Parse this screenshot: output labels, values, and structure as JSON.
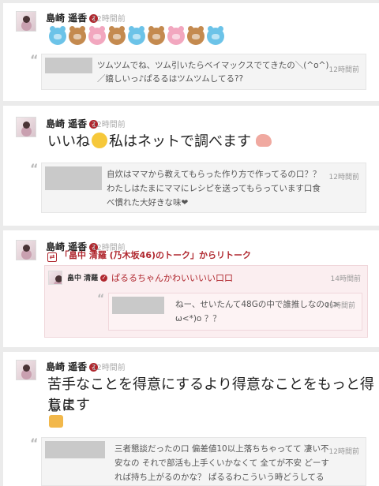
{
  "posts": [
    {
      "author": "島崎 遥香",
      "time": "12時間前",
      "emoji": [
        "blue-bear-icon",
        "brown-bear-icon",
        "pink-pig-icon",
        "brown-bear-icon",
        "blue-bear-icon",
        "brown-bear-icon",
        "pink-pig-icon",
        "brown-bear-icon",
        "blue-bear-icon"
      ],
      "reply": {
        "text_line1": "ツムツムでね、ツム引いたらベイマックスでてきたの＼(^o^)",
        "text_line2": "／嬉しいっ♪ぱるるはツムツムしてる??",
        "time": "12時間前"
      }
    },
    {
      "author": "島崎 遥香",
      "time": "12時間前",
      "text_before": "いいね",
      "text_after": "私はネットで調べます",
      "reply": {
        "text_line1": "自炊はママから教えてもらった作り方で作ってるの口？？",
        "text_line2": "わたしはたまにママにレシピを送ってもらっています口食",
        "text_line3": "べ慣れた大好きな味❤",
        "time": "12時間前"
      }
    },
    {
      "author": "島崎 遥香",
      "time": "12時間前",
      "retalk_label": "「畠中 清羅 (乃木坂46)のトーク」からリトーク",
      "retalk": {
        "author": "畠中 清羅",
        "text": "ぱるるちゃんかわいいいい口口",
        "time": "14時間前",
        "reply": {
          "text_line1": "ねー、せいたんて48Gの中で誰推しなのo(>",
          "text_line2": "ω<*)o ？？",
          "time": "15時間前"
        }
      }
    },
    {
      "author": "島崎 遥香",
      "time": "12時間前",
      "text_line1": "苦手なことを得意にするより得意なことをもっと得意に",
      "text_line2": "します",
      "reply": {
        "text_line1": "三者懇談だったの口 偏差値10以上落ちちゃってて 凄い不",
        "text_line2": "安なの それで部活も上手くいかなくて 全てが不安 どーす",
        "text_line3": "れば持ち上がるのかな？ ぱるるわこういう時どうしてる",
        "time": "12時間前"
      }
    }
  ],
  "colors": {
    "accent": "#b0282f",
    "background": "#ebebeb",
    "card": "#ffffff",
    "pink": "#fbeef0"
  }
}
